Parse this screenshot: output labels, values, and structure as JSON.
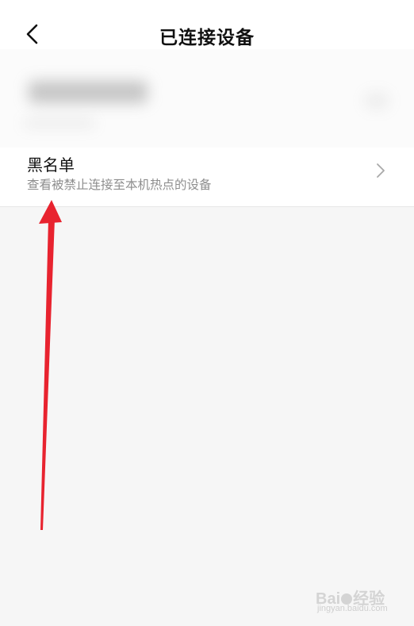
{
  "header": {
    "title": "已连接设备",
    "back_icon": "chevron-left-icon"
  },
  "device": {
    "blurred": true
  },
  "blacklist": {
    "title": "黑名单",
    "subtitle": "查看被禁止连接至本机热点的设备",
    "chevron_icon": "chevron-right-icon"
  },
  "annotation": {
    "arrow_color": "#e8232f"
  },
  "watermark": {
    "logo_text": "Bai",
    "logo_suffix": "经验",
    "url": "jingyan.baidu.com"
  },
  "colors": {
    "background": "#f6f6f6",
    "card": "#ffffff",
    "title_text": "#111111",
    "subtitle_text": "#8e8e8e"
  }
}
